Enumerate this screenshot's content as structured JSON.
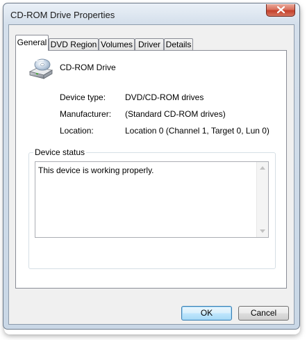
{
  "window": {
    "title": "CD-ROM Drive Properties"
  },
  "tabs": [
    {
      "label": "General",
      "active": true
    },
    {
      "label": "DVD Region",
      "active": false
    },
    {
      "label": "Volumes",
      "active": false
    },
    {
      "label": "Driver",
      "active": false
    },
    {
      "label": "Details",
      "active": false
    }
  ],
  "device": {
    "name": "CD-ROM Drive",
    "icon": "cd-drive-icon"
  },
  "properties": [
    {
      "label": "Device type:",
      "value": "DVD/CD-ROM drives"
    },
    {
      "label": "Manufacturer:",
      "value": "(Standard CD-ROM drives)"
    },
    {
      "label": "Location:",
      "value": "Location 0 (Channel 1, Target 0, Lun 0)"
    }
  ],
  "status": {
    "group_label": "Device status",
    "text": "This device is working properly."
  },
  "buttons": {
    "ok": "OK",
    "cancel": "Cancel"
  },
  "colors": {
    "close_button": "#c4402b",
    "default_button_border": "#3c7fb1"
  }
}
